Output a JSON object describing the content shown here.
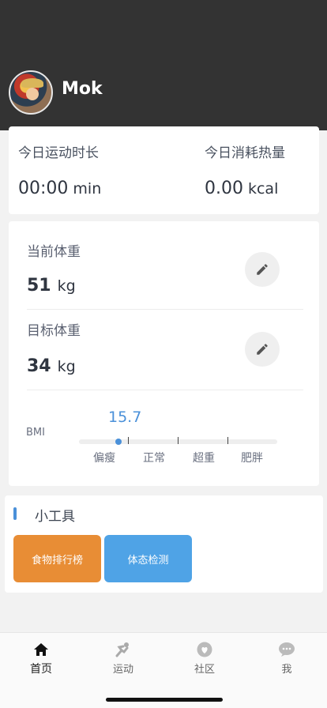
{
  "profile": {
    "username": "Mok"
  },
  "today": {
    "duration_label": "今日运动时长",
    "duration_value": "00:00",
    "duration_unit": "min",
    "calories_label": "今日消耗热量",
    "calories_value": "0.00",
    "calories_unit": "kcal"
  },
  "weight": {
    "current_label": "当前体重",
    "current_value": "51",
    "target_label": "目标体重",
    "target_value": "34",
    "unit": "kg",
    "edit_icon": "pencil-icon"
  },
  "bmi": {
    "label": "BMI",
    "value": "15.7",
    "marker_fraction": 0.2,
    "categories": [
      "偏瘦",
      "正常",
      "超重",
      "肥胖"
    ],
    "accent_color": "#4a90d9"
  },
  "tools": {
    "title": "小工具",
    "buttons": [
      {
        "label": "食物排行榜",
        "color": "#e88d35"
      },
      {
        "label": "体态检测",
        "color": "#4fa3e6"
      }
    ]
  },
  "tabbar": {
    "items": [
      {
        "label": "首页",
        "icon": "home-icon",
        "active": true
      },
      {
        "label": "运动",
        "icon": "sport-icon",
        "active": false
      },
      {
        "label": "社区",
        "icon": "community-icon",
        "active": false
      },
      {
        "label": "我",
        "icon": "profile-chat-icon",
        "active": false
      }
    ]
  }
}
